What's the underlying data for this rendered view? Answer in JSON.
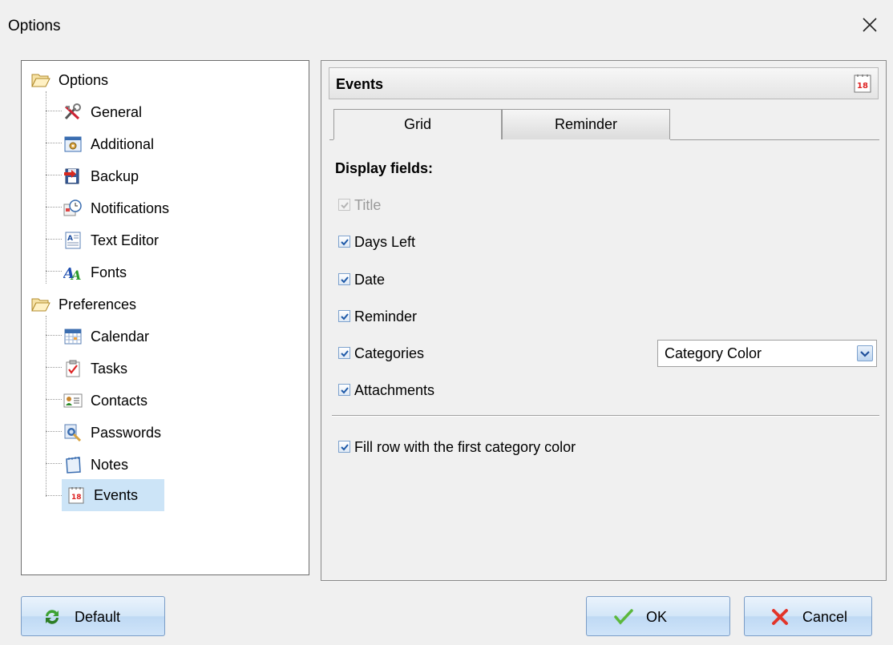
{
  "window": {
    "title": "Options"
  },
  "tree": {
    "groups": [
      {
        "label": "Options",
        "items": [
          {
            "label": "General",
            "icon": "tools-icon"
          },
          {
            "label": "Additional",
            "icon": "gear-window-icon"
          },
          {
            "label": "Backup",
            "icon": "backup-icon"
          },
          {
            "label": "Notifications",
            "icon": "notification-clock-icon"
          },
          {
            "label": "Text Editor",
            "icon": "text-editor-icon"
          },
          {
            "label": "Fonts",
            "icon": "fonts-icon"
          }
        ]
      },
      {
        "label": "Preferences",
        "items": [
          {
            "label": "Calendar",
            "icon": "calendar-icon"
          },
          {
            "label": "Tasks",
            "icon": "tasks-icon"
          },
          {
            "label": "Contacts",
            "icon": "contacts-icon"
          },
          {
            "label": "Passwords",
            "icon": "passwords-icon"
          },
          {
            "label": "Notes",
            "icon": "notes-icon"
          },
          {
            "label": "Events",
            "icon": "events-calendar-icon",
            "selected": true
          }
        ]
      }
    ]
  },
  "panel": {
    "title": "Events",
    "calendar_badge": "18",
    "tabs": [
      {
        "label": "Grid",
        "active": true
      },
      {
        "label": "Reminder",
        "active": false
      }
    ],
    "section_title": "Display fields:",
    "fields": [
      {
        "label": "Title",
        "checked": true,
        "disabled": true
      },
      {
        "label": "Days Left",
        "checked": true,
        "disabled": false
      },
      {
        "label": "Date",
        "checked": true,
        "disabled": false
      },
      {
        "label": "Reminder",
        "checked": true,
        "disabled": false
      },
      {
        "label": "Categories",
        "checked": true,
        "disabled": false
      },
      {
        "label": "Attachments",
        "checked": true,
        "disabled": false
      }
    ],
    "category_combo": {
      "value": "Category Color"
    },
    "fill_row": {
      "label": "Fill row with the first category color",
      "checked": true
    }
  },
  "buttons": {
    "default_label": "Default",
    "ok_label": "OK",
    "cancel_label": "Cancel"
  },
  "colors": {
    "selection": "#cce4f7",
    "checkbox_border": "#7da2ce",
    "check_mark": "#1f5aa8"
  }
}
